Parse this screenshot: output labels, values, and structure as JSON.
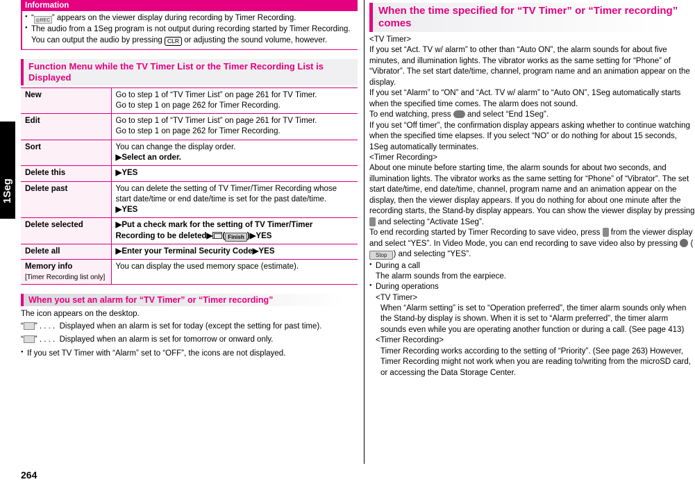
{
  "page": {
    "number": "264",
    "tab_label": "1Seg"
  },
  "information": {
    "title": "Information",
    "items": [
      {
        "pre": "“",
        "icon": "rec-indicator-icon",
        "post": "” appears on the viewer display during recording by Timer Recording."
      },
      {
        "text_1": "The audio from a 1Seg program is not output during recording started by Timer Recording. You can output the audio by pressing ",
        "key": "CLR",
        "text_2": " or adjusting the sound volume, however."
      }
    ]
  },
  "function_menu": {
    "heading": "Function Menu while the TV Timer List or the Timer Recording List is Displayed",
    "rows": [
      {
        "name": "New",
        "lines": [
          "Go to step 1 of “TV Timer List” on page 261 for TV Timer.",
          "Go to step 1 on page 262 for Timer Recording."
        ]
      },
      {
        "name": "Edit",
        "lines": [
          "Go to step 1 of “TV Timer List” on page 261 for TV Timer.",
          "Go to step 1 on page 262 for Timer Recording."
        ]
      },
      {
        "name": "Sort",
        "lines": [
          "You can change the display order.",
          "▶Select an order."
        ]
      },
      {
        "name": "Delete this",
        "lines": [
          "▶YES"
        ]
      },
      {
        "name": "Delete past",
        "lines": [
          "You can delete the setting of TV Timer/Timer Recording whose start date/time or end date/time is set for the past date/time.",
          "▶YES"
        ]
      },
      {
        "name": "Delete selected",
        "lines": [
          "▶Put a check mark for the setting of TV Timer/Timer Recording to be deleted▶",
          "▶YES"
        ],
        "inline_key": "Finish"
      },
      {
        "name": "Delete all",
        "lines": [
          "▶Enter your Terminal Security Code▶YES"
        ]
      },
      {
        "name": "Memory info",
        "name_note": "[Timer Recording list only]",
        "lines": [
          "You can display the used memory space (estimate)."
        ]
      }
    ]
  },
  "alarm_section": {
    "heading": "When you set an alarm for “TV Timer” or “Timer recording”",
    "intro": "The icon appears on the desktop.",
    "icon_lines": [
      {
        "icon": "alarm-today-icon",
        "dots": "“    ” . . . .",
        "text": "Displayed when an alarm is set for today (except the setting for past time)."
      },
      {
        "icon": "alarm-tomorrow-icon",
        "dots": "“    ” . . . .",
        "text": "Displayed when an alarm is set for tomorrow or onward only."
      }
    ],
    "note": "If you set TV Timer with “Alarm” set to “OFF”, the icons are not displayed."
  },
  "right_column": {
    "heading": "When the time specified for “TV Timer” or “Timer recording” comes",
    "tv_timer_label": "<TV Timer>",
    "tv_timer_paragraphs": [
      "If you set “Act. TV w/ alarm” to other than “Auto ON”, the alarm sounds for about five minutes, and illumination lights. The vibrator works as the same setting for “Phone” of “Vibrator”. The set start date/time, channel, program name and an animation appear on the display.",
      "If you set “Alarm” to “ON” and “Act. TV w/ alarm” to “Auto ON”, 1Seg automatically starts when the specified time comes. The alarm does not sound."
    ],
    "end_watching": {
      "pre": "To end watching, press ",
      "key": "end-key",
      "post": " and select “End 1Seg”."
    },
    "off_timer_paragraph": "If you set “Off timer”, the confirmation display appears asking whether to continue watching when the specified time elapses. If you select “NO” or do nothing for about 15 seconds, 1Seg automatically terminates.",
    "timer_rec_label": "<Timer Recording>",
    "timer_rec_paragraph_1": "About one minute before starting time, the alarm sounds for about two seconds, and illumination lights. The vibrator works as the same setting for “Phone” of “Vibrator”. The set start date/time, end date/time, channel, program name and an animation appear on the display, then the viewer display appears. If you do nothing for about one minute after the recording starts, the Stand-by display appears. You can show the viewer display by pressing",
    "timer_rec_paragraph_1b": " and selecting “Activate 1Seg”.",
    "timer_rec_paragraph_2a": "To end recording started by Timer Recording to save video, press",
    "timer_rec_paragraph_2b": " from the viewer display and select “YES”. In Video Mode, you can end recording to save video also by pressing",
    "timer_rec_paragraph_2c": " (",
    "stop_label": "Stop",
    "timer_rec_paragraph_2d": ") and selecting “YES”.",
    "bullets": [
      {
        "label": "During a call",
        "lines": [
          "The alarm sounds from the earpiece."
        ]
      },
      {
        "label": "During operations",
        "sub": [
          {
            "tag": "<TV Timer>",
            "text": "When “Alarm setting” is set to “Operation preferred”, the timer alarm sounds only when the Stand-by display is shown. When it is set to “Alarm preferred”, the timer alarm sounds even while you are operating another function or during a call. (See page 413)"
          },
          {
            "tag": "<Timer Recording>",
            "text": "Timer Recording works according to the setting of “Priority”. (See page 263) However, Timer Recording might not work when you are reading to/writing from the microSD card, or accessing the Data Storage Center."
          }
        ]
      }
    ]
  },
  "colors": {
    "accent": "#e4007f",
    "table_rule": "#d6007f",
    "header_bg": "#f0eff1"
  }
}
